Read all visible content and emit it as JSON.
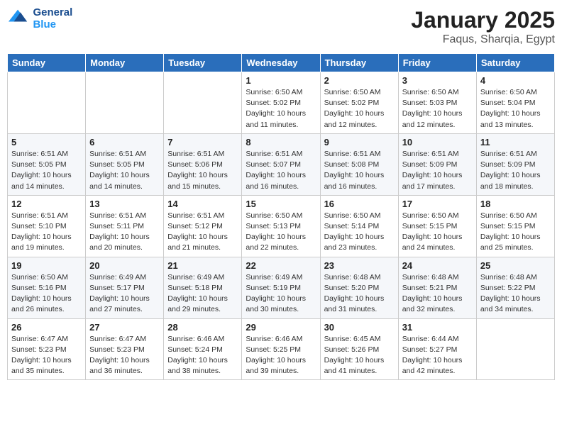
{
  "logo": {
    "text_general": "General",
    "text_blue": "Blue"
  },
  "title": "January 2025",
  "subtitle": "Faqus, Sharqia, Egypt",
  "header_days": [
    "Sunday",
    "Monday",
    "Tuesday",
    "Wednesday",
    "Thursday",
    "Friday",
    "Saturday"
  ],
  "weeks": [
    [
      {
        "day": "",
        "info": ""
      },
      {
        "day": "",
        "info": ""
      },
      {
        "day": "",
        "info": ""
      },
      {
        "day": "1",
        "info": "Sunrise: 6:50 AM\nSunset: 5:02 PM\nDaylight: 10 hours and 11 minutes."
      },
      {
        "day": "2",
        "info": "Sunrise: 6:50 AM\nSunset: 5:02 PM\nDaylight: 10 hours and 12 minutes."
      },
      {
        "day": "3",
        "info": "Sunrise: 6:50 AM\nSunset: 5:03 PM\nDaylight: 10 hours and 12 minutes."
      },
      {
        "day": "4",
        "info": "Sunrise: 6:50 AM\nSunset: 5:04 PM\nDaylight: 10 hours and 13 minutes."
      }
    ],
    [
      {
        "day": "5",
        "info": "Sunrise: 6:51 AM\nSunset: 5:05 PM\nDaylight: 10 hours and 14 minutes."
      },
      {
        "day": "6",
        "info": "Sunrise: 6:51 AM\nSunset: 5:05 PM\nDaylight: 10 hours and 14 minutes."
      },
      {
        "day": "7",
        "info": "Sunrise: 6:51 AM\nSunset: 5:06 PM\nDaylight: 10 hours and 15 minutes."
      },
      {
        "day": "8",
        "info": "Sunrise: 6:51 AM\nSunset: 5:07 PM\nDaylight: 10 hours and 16 minutes."
      },
      {
        "day": "9",
        "info": "Sunrise: 6:51 AM\nSunset: 5:08 PM\nDaylight: 10 hours and 16 minutes."
      },
      {
        "day": "10",
        "info": "Sunrise: 6:51 AM\nSunset: 5:09 PM\nDaylight: 10 hours and 17 minutes."
      },
      {
        "day": "11",
        "info": "Sunrise: 6:51 AM\nSunset: 5:09 PM\nDaylight: 10 hours and 18 minutes."
      }
    ],
    [
      {
        "day": "12",
        "info": "Sunrise: 6:51 AM\nSunset: 5:10 PM\nDaylight: 10 hours and 19 minutes."
      },
      {
        "day": "13",
        "info": "Sunrise: 6:51 AM\nSunset: 5:11 PM\nDaylight: 10 hours and 20 minutes."
      },
      {
        "day": "14",
        "info": "Sunrise: 6:51 AM\nSunset: 5:12 PM\nDaylight: 10 hours and 21 minutes."
      },
      {
        "day": "15",
        "info": "Sunrise: 6:50 AM\nSunset: 5:13 PM\nDaylight: 10 hours and 22 minutes."
      },
      {
        "day": "16",
        "info": "Sunrise: 6:50 AM\nSunset: 5:14 PM\nDaylight: 10 hours and 23 minutes."
      },
      {
        "day": "17",
        "info": "Sunrise: 6:50 AM\nSunset: 5:15 PM\nDaylight: 10 hours and 24 minutes."
      },
      {
        "day": "18",
        "info": "Sunrise: 6:50 AM\nSunset: 5:15 PM\nDaylight: 10 hours and 25 minutes."
      }
    ],
    [
      {
        "day": "19",
        "info": "Sunrise: 6:50 AM\nSunset: 5:16 PM\nDaylight: 10 hours and 26 minutes."
      },
      {
        "day": "20",
        "info": "Sunrise: 6:49 AM\nSunset: 5:17 PM\nDaylight: 10 hours and 27 minutes."
      },
      {
        "day": "21",
        "info": "Sunrise: 6:49 AM\nSunset: 5:18 PM\nDaylight: 10 hours and 29 minutes."
      },
      {
        "day": "22",
        "info": "Sunrise: 6:49 AM\nSunset: 5:19 PM\nDaylight: 10 hours and 30 minutes."
      },
      {
        "day": "23",
        "info": "Sunrise: 6:48 AM\nSunset: 5:20 PM\nDaylight: 10 hours and 31 minutes."
      },
      {
        "day": "24",
        "info": "Sunrise: 6:48 AM\nSunset: 5:21 PM\nDaylight: 10 hours and 32 minutes."
      },
      {
        "day": "25",
        "info": "Sunrise: 6:48 AM\nSunset: 5:22 PM\nDaylight: 10 hours and 34 minutes."
      }
    ],
    [
      {
        "day": "26",
        "info": "Sunrise: 6:47 AM\nSunset: 5:23 PM\nDaylight: 10 hours and 35 minutes."
      },
      {
        "day": "27",
        "info": "Sunrise: 6:47 AM\nSunset: 5:23 PM\nDaylight: 10 hours and 36 minutes."
      },
      {
        "day": "28",
        "info": "Sunrise: 6:46 AM\nSunset: 5:24 PM\nDaylight: 10 hours and 38 minutes."
      },
      {
        "day": "29",
        "info": "Sunrise: 6:46 AM\nSunset: 5:25 PM\nDaylight: 10 hours and 39 minutes."
      },
      {
        "day": "30",
        "info": "Sunrise: 6:45 AM\nSunset: 5:26 PM\nDaylight: 10 hours and 41 minutes."
      },
      {
        "day": "31",
        "info": "Sunrise: 6:44 AM\nSunset: 5:27 PM\nDaylight: 10 hours and 42 minutes."
      },
      {
        "day": "",
        "info": ""
      }
    ]
  ]
}
